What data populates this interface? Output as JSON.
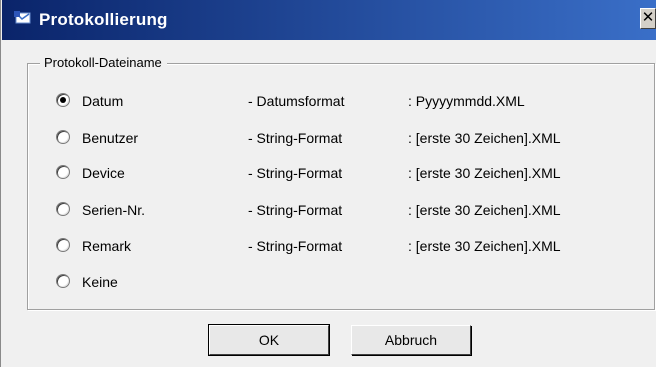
{
  "window": {
    "title": "Protokollierung",
    "close_glyph": "✕"
  },
  "group": {
    "legend": "Protokoll-Dateiname",
    "options": [
      {
        "label": "Datum",
        "format": "- Datumsformat",
        "example": ": Pyyyymmdd.XML",
        "selected": true
      },
      {
        "label": "Benutzer",
        "format": "- String-Format",
        "example": ": [erste 30 Zeichen].XML",
        "selected": false
      },
      {
        "label": "Device",
        "format": "- String-Format",
        "example": ": [erste 30 Zeichen].XML",
        "selected": false
      },
      {
        "label": "Serien-Nr.",
        "format": "- String-Format",
        "example": ": [erste 30 Zeichen].XML",
        "selected": false
      },
      {
        "label": "Remark",
        "format": "- String-Format",
        "example": ": [erste 30 Zeichen].XML",
        "selected": false
      },
      {
        "label": "Keine",
        "format": "",
        "example": "",
        "selected": false
      }
    ]
  },
  "buttons": {
    "ok": "OK",
    "cancel": "Abbruch"
  },
  "colors": {
    "title_gradient_start": "#0a246a",
    "title_gradient_end": "#3a6fc8",
    "dialog_bg": "#f0f0f0"
  }
}
